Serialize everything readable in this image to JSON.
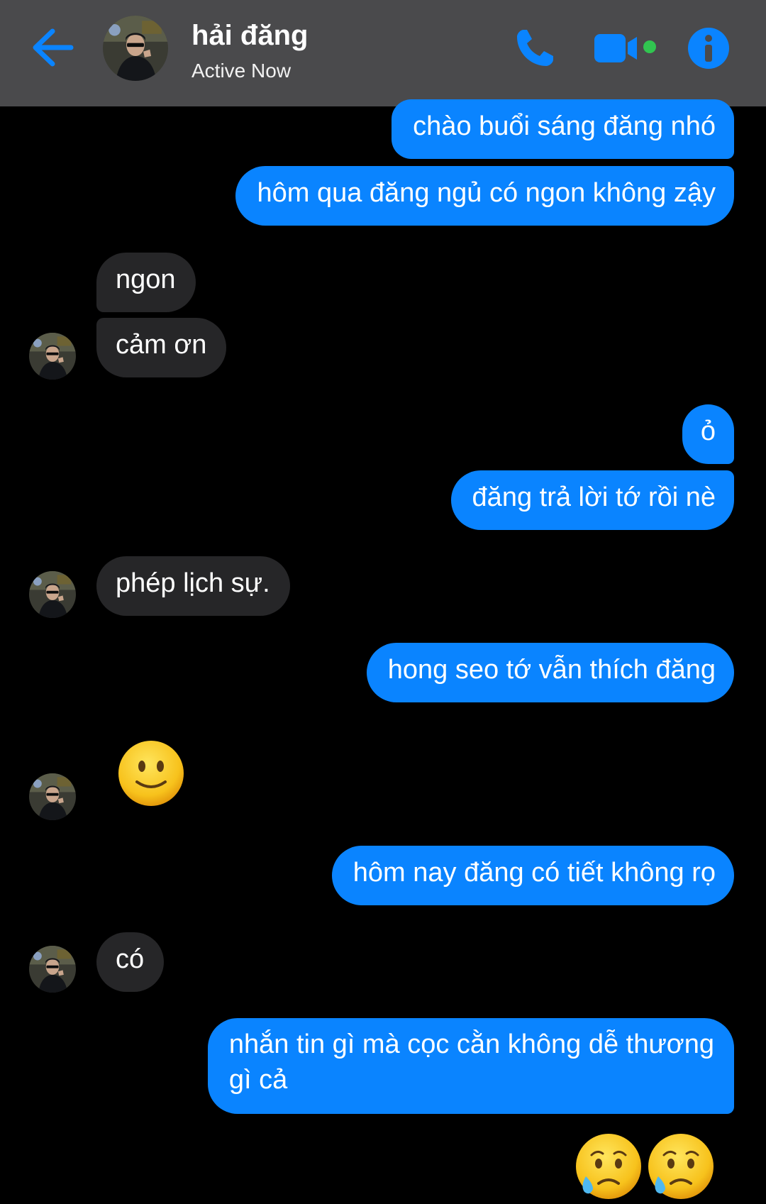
{
  "header": {
    "contact_name": "hải đăng",
    "status": "Active Now",
    "back_icon": "back-arrow-icon",
    "call_icon": "phone-icon",
    "video_icon": "video-camera-icon",
    "info_icon": "info-icon",
    "online_indicator_color": "#31c550",
    "accent_color": "#0a84ff"
  },
  "messages": [
    {
      "sender": "me",
      "text": "chào buổi sáng đăng nhó"
    },
    {
      "sender": "me",
      "text": "hôm qua đăng ngủ có ngon không zậy"
    },
    {
      "sender": "them",
      "text": "ngon"
    },
    {
      "sender": "them",
      "text": "cảm ơn"
    },
    {
      "sender": "me",
      "text": "ỏ"
    },
    {
      "sender": "me",
      "text": "đăng trả lời tớ rồi nè"
    },
    {
      "sender": "them",
      "text": "phép lịch sự."
    },
    {
      "sender": "me",
      "text": "hong seo tớ vẫn thích đăng"
    },
    {
      "sender": "them",
      "emoji": "slightly-smiling-face-emoji"
    },
    {
      "sender": "me",
      "text": "hôm nay đăng có tiết không rọ"
    },
    {
      "sender": "them",
      "text": "có"
    },
    {
      "sender": "me",
      "text_line1": "nhắn tin gì mà cọc cằn không dễ thương",
      "text_line2": "gì cả"
    },
    {
      "sender": "me",
      "emoji": "sad-but-relieved-face-emoji",
      "count": 2
    }
  ],
  "colors": {
    "outgoing_bubble": "#0a84ff",
    "incoming_bubble": "#262628",
    "header_bg": "#4a4a4c",
    "background": "#000000"
  }
}
